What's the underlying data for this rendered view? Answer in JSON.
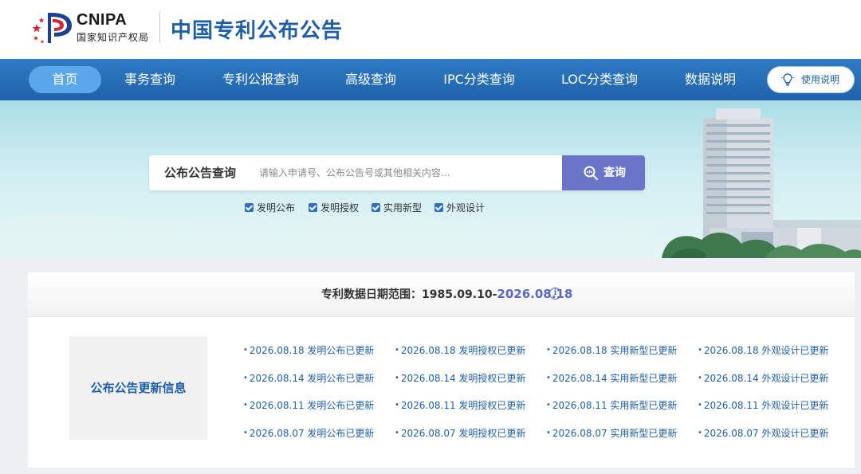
{
  "header": {
    "logo_en": "CNIPA",
    "logo_cn": "国家知识产权局",
    "site_title": "中国专利公布公告"
  },
  "nav": {
    "items": [
      {
        "label": "首页",
        "active": true
      },
      {
        "label": "事务查询"
      },
      {
        "label": "专利公报查询"
      },
      {
        "label": "高级查询"
      },
      {
        "label": "IPC分类查询"
      },
      {
        "label": "LOC分类查询"
      },
      {
        "label": "数据说明"
      }
    ],
    "help_label": "使用说明"
  },
  "search": {
    "label": "公布公告查询",
    "placeholder": "请输入申请号、公布公告号或其他相关内容...",
    "button_label": "查询",
    "checkboxes": [
      {
        "label": "发明公布",
        "checked": true
      },
      {
        "label": "发明授权",
        "checked": true
      },
      {
        "label": "实用新型",
        "checked": true
      },
      {
        "label": "外观设计",
        "checked": true
      }
    ]
  },
  "date_range": {
    "prefix": "专利数据日期范围：1985.09.10-",
    "end": "2026.08.18"
  },
  "updates": {
    "title": "公布公告更新信息",
    "rows": [
      [
        "2026.08.18 发明公布已更新",
        "2026.08.18 发明授权已更新",
        "2026.08.18 实用新型已更新",
        "2026.08.18 外观设计已更新"
      ],
      [
        "2026.08.14 发明公布已更新",
        "2026.08.14 发明授权已更新",
        "2026.08.14 实用新型已更新",
        "2026.08.14 外观设计已更新"
      ],
      [
        "2026.08.11 发明公布已更新",
        "2026.08.11 发明授权已更新",
        "2026.08.11 实用新型已更新",
        "2026.08.11 外观设计已更新"
      ],
      [
        "2026.08.07 发明公布已更新",
        "2026.08.07 发明授权已更新",
        "2026.08.07 实用新型已更新",
        "2026.08.07 外观设计已更新"
      ]
    ]
  },
  "colors": {
    "brand_blue": "#1f5fa8",
    "nav_blue": "#2f7bc4",
    "nav_active": "#5aa8ea",
    "search_button": "#6a75c9",
    "date_accent": "#5a67c4"
  }
}
